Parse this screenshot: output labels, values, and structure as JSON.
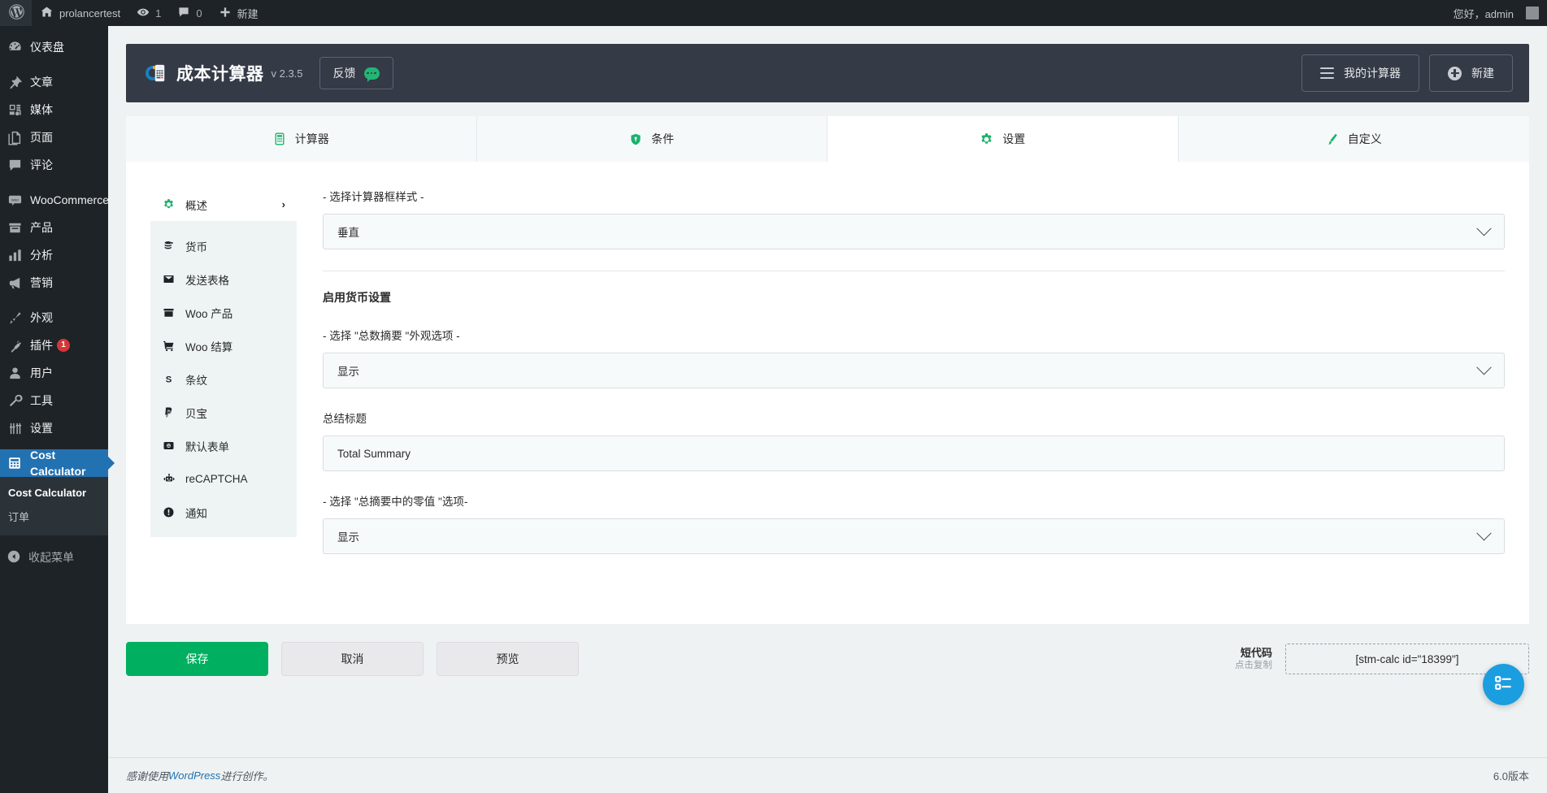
{
  "adminbar": {
    "logo_icon": "wordpress-icon",
    "site_home_icon": "home-icon",
    "site_name": "prolancertest",
    "updates_icon": "updates-icon",
    "updates_count": "1",
    "comments_icon": "comment-icon",
    "comments_count": "0",
    "new_icon": "plus-icon",
    "new_label": "新建",
    "howdy": "您好，admin",
    "avatar_icon": "avatar"
  },
  "sidebar": {
    "items": [
      {
        "label": "仪表盘",
        "icon": "dashboard-icon"
      },
      {
        "label": "文章",
        "icon": "pin-icon"
      },
      {
        "label": "媒体",
        "icon": "media-icon"
      },
      {
        "label": "页面",
        "icon": "pages-icon"
      },
      {
        "label": "评论",
        "icon": "comment-icon"
      },
      {
        "label": "WooCommerce",
        "icon": "woo-icon"
      },
      {
        "label": "产品",
        "icon": "products-icon"
      },
      {
        "label": "分析",
        "icon": "analytics-icon"
      },
      {
        "label": "营销",
        "icon": "marketing-icon"
      },
      {
        "label": "外观",
        "icon": "appearance-icon"
      },
      {
        "label": "插件",
        "icon": "plugins-icon",
        "badge": "1"
      },
      {
        "label": "用户",
        "icon": "users-icon"
      },
      {
        "label": "工具",
        "icon": "tools-icon"
      },
      {
        "label": "设置",
        "icon": "settings-icon"
      },
      {
        "label": "Cost Calculator",
        "icon": "calculator-icon",
        "current": true
      }
    ],
    "submenu": [
      {
        "label": "Cost Calculator",
        "current": true
      },
      {
        "label": "订单",
        "current": false
      }
    ],
    "collapse": {
      "label": "收起菜单",
      "icon": "collapse-icon"
    }
  },
  "plugin_header": {
    "logo_icon": "cost-calculator-logo",
    "title": "成本计算器",
    "version": "v 2.3.5",
    "feedback_label": "反馈",
    "feedback_icon": "chat-bubble-icon",
    "my_calculators_label": "我的计算器",
    "my_calculators_icon": "hamburger-icon",
    "new_label": "新建",
    "new_icon": "plus-circle-icon"
  },
  "tabs": [
    {
      "label": "计算器",
      "icon": "calculator-icon",
      "active": false
    },
    {
      "label": "条件",
      "icon": "shield-icon",
      "active": false
    },
    {
      "label": "设置",
      "icon": "gear-icon",
      "active": true
    },
    {
      "label": "自定义",
      "icon": "brush-icon",
      "active": false
    }
  ],
  "settings_nav": {
    "overview": {
      "label": "概述",
      "icon": "gear-icon",
      "chevron": "›"
    },
    "items": [
      {
        "label": "货币",
        "icon": "coins-icon"
      },
      {
        "label": "发送表格",
        "icon": "envelope-icon"
      },
      {
        "label": "Woo 产品",
        "icon": "box-icon"
      },
      {
        "label": "Woo 结算",
        "icon": "cart-icon"
      },
      {
        "label": "条纹",
        "icon": "stripe-icon"
      },
      {
        "label": "贝宝",
        "icon": "paypal-icon"
      },
      {
        "label": "默认表单",
        "icon": "form-icon"
      },
      {
        "label": "reCAPTCHA",
        "icon": "robot-icon"
      },
      {
        "label": "通知",
        "icon": "alert-icon"
      }
    ]
  },
  "form": {
    "style_label": "- 选择计算器框样式 -",
    "style_value": "垂直",
    "currency_heading": "启用货币设置",
    "summary_appearance_label": "- 选择 \"总数摘要 \"外观选项 -",
    "summary_appearance_value": "显示",
    "summary_title_label": "总结标题",
    "summary_title_value": "Total Summary",
    "zero_values_label": "- 选择 \"总摘要中的零值 \"选项-",
    "zero_values_value": "显示"
  },
  "actions": {
    "save_label": "保存",
    "cancel_label": "取消",
    "preview_label": "预览",
    "shortcode_title": "短代码",
    "shortcode_sub": "点击复制",
    "shortcode_value": "[stm-calc id=\"18399\"]"
  },
  "fab": {
    "icon": "checklist-icon",
    "color": "#1a9ee0"
  },
  "footer": {
    "thanks_prefix": "感谢使用 ",
    "wordpress_link": "WordPress",
    "thanks_suffix": " 进行创作。",
    "version": "6.0版本"
  },
  "colors": {
    "accent_green": "#19b36b",
    "save_green": "#00b060",
    "admin_dark": "#1d2327",
    "current_blue": "#2271b1",
    "plugin_header": "#343a46"
  }
}
